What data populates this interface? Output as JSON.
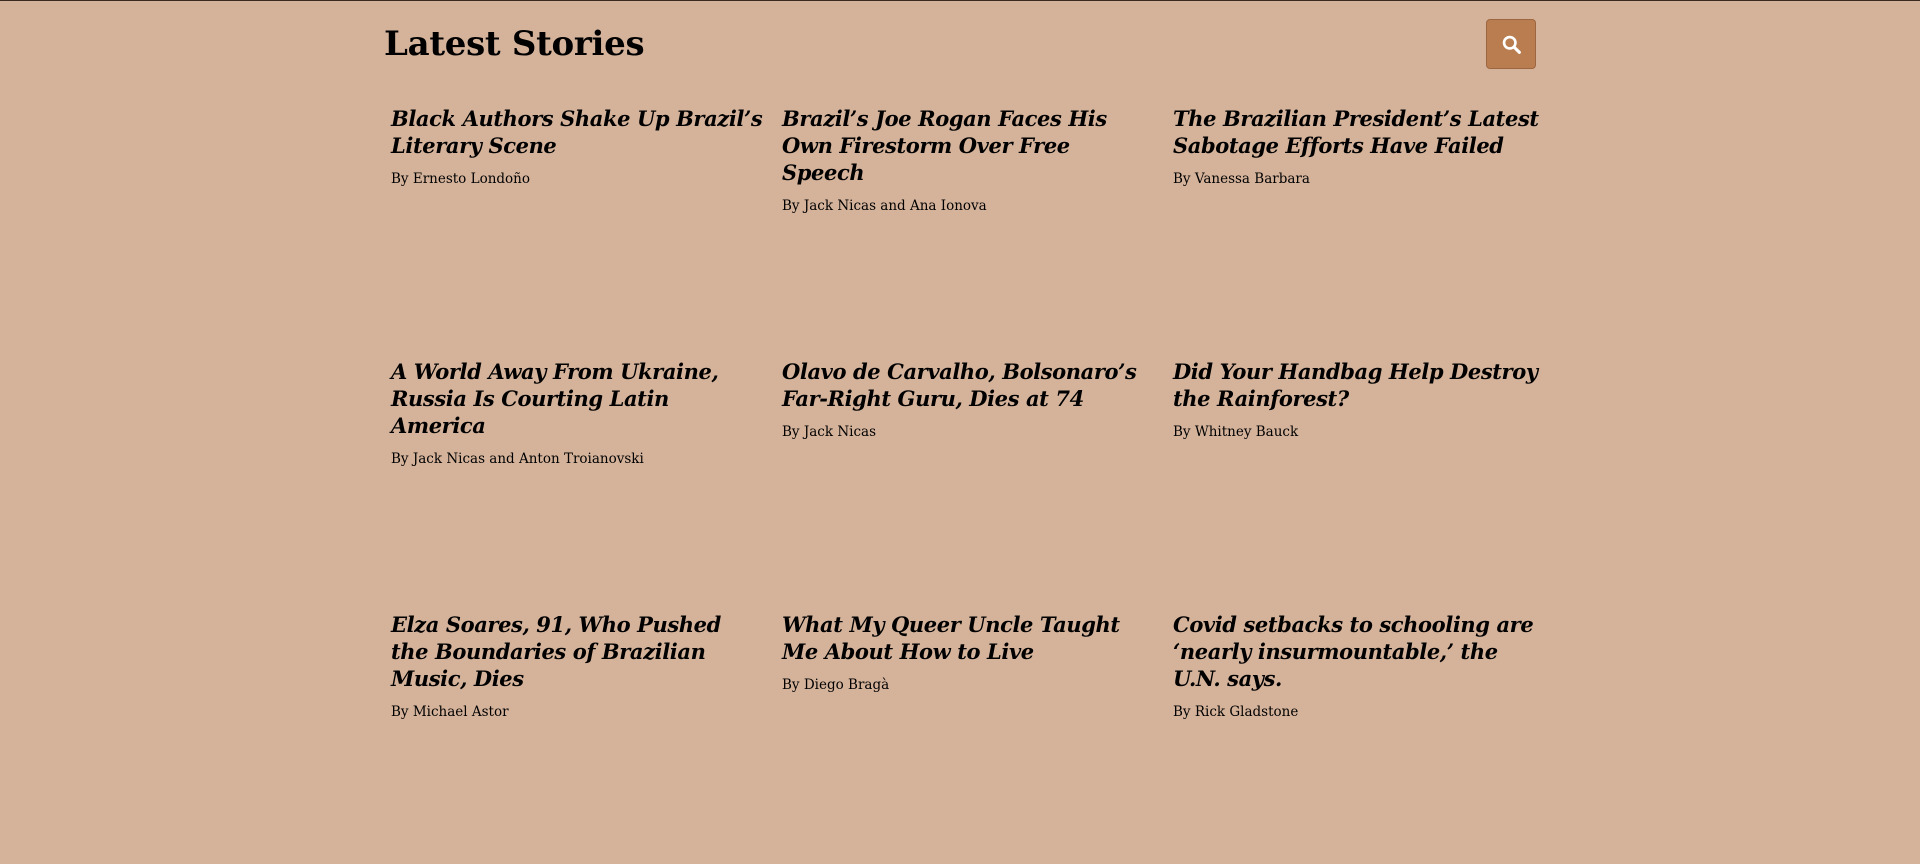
{
  "header": {
    "title": "Latest Stories",
    "search_icon": "search-icon"
  },
  "stories": [
    {
      "title": "Black Authors Shake Up Brazil’s Literary Scene",
      "byline": "By Ernesto Londoño"
    },
    {
      "title": "Brazil’s Joe Rogan Faces His Own Firestorm Over Free Speech",
      "byline": "By Jack Nicas and Ana Ionova"
    },
    {
      "title": "The Brazilian President’s Latest Sabotage Efforts Have Failed",
      "byline": "By Vanessa Barbara"
    },
    {
      "title": "A World Away From Ukraine, Russia Is Courting Latin America",
      "byline": "By Jack Nicas and Anton Troianovski"
    },
    {
      "title": "Olavo de Carvalho, Bolsonaro’s Far-Right Guru, Dies at 74",
      "byline": "By Jack Nicas"
    },
    {
      "title": "Did Your Handbag Help Destroy the Rainforest?",
      "byline": "By Whitney Bauck"
    },
    {
      "title": "Elza Soares, 91, Who Pushed the Boundaries of Brazilian Music, Dies",
      "byline": "By Michael Astor"
    },
    {
      "title": "What My Queer Uncle Taught Me About How to Live",
      "byline": "By Diego Bragà"
    },
    {
      "title": "Covid setbacks to schooling are ‘nearly insurmountable,’ the U.N. says.",
      "byline": "By Rick Gladstone"
    }
  ],
  "colors": {
    "background": "#d5b39b",
    "accent": "#b97d50",
    "text": "#000000"
  }
}
